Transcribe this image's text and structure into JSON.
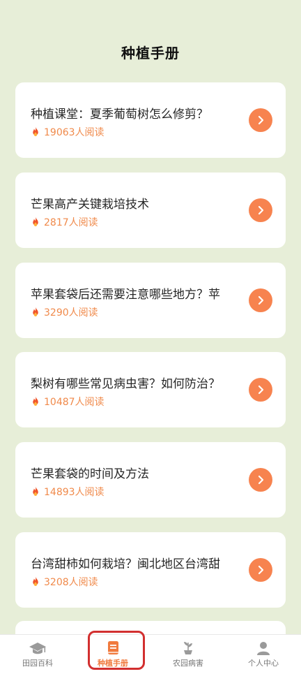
{
  "header": {
    "title": "种植手册"
  },
  "articles": [
    {
      "title": "种植课堂：夏季葡萄树怎么修剪？",
      "reads": "19063人阅读"
    },
    {
      "title": "芒果高产关键栽培技术",
      "reads": "2817人阅读"
    },
    {
      "title": "苹果套袋后还需要注意哪些地方？苹",
      "reads": "3290人阅读"
    },
    {
      "title": "梨树有哪些常见病虫害？如何防治？",
      "reads": "10487人阅读"
    },
    {
      "title": "芒果套袋的时间及方法",
      "reads": "14893人阅读"
    },
    {
      "title": "台湾甜柿如何栽培？闽北地区台湾甜",
      "reads": "3208人阅读"
    }
  ],
  "tabs": [
    {
      "label": "田园百科",
      "icon": "graduation-cap-icon",
      "active": false
    },
    {
      "label": "种植手册",
      "icon": "book-icon",
      "active": true
    },
    {
      "label": "农园病害",
      "icon": "plant-icon",
      "active": false
    },
    {
      "label": "个人中心",
      "icon": "person-icon",
      "active": false
    }
  ],
  "colors": {
    "background": "#e7eed8",
    "accent": "#f7834f",
    "reads_text": "#f08a4b",
    "highlight_box": "#d22f2f"
  }
}
